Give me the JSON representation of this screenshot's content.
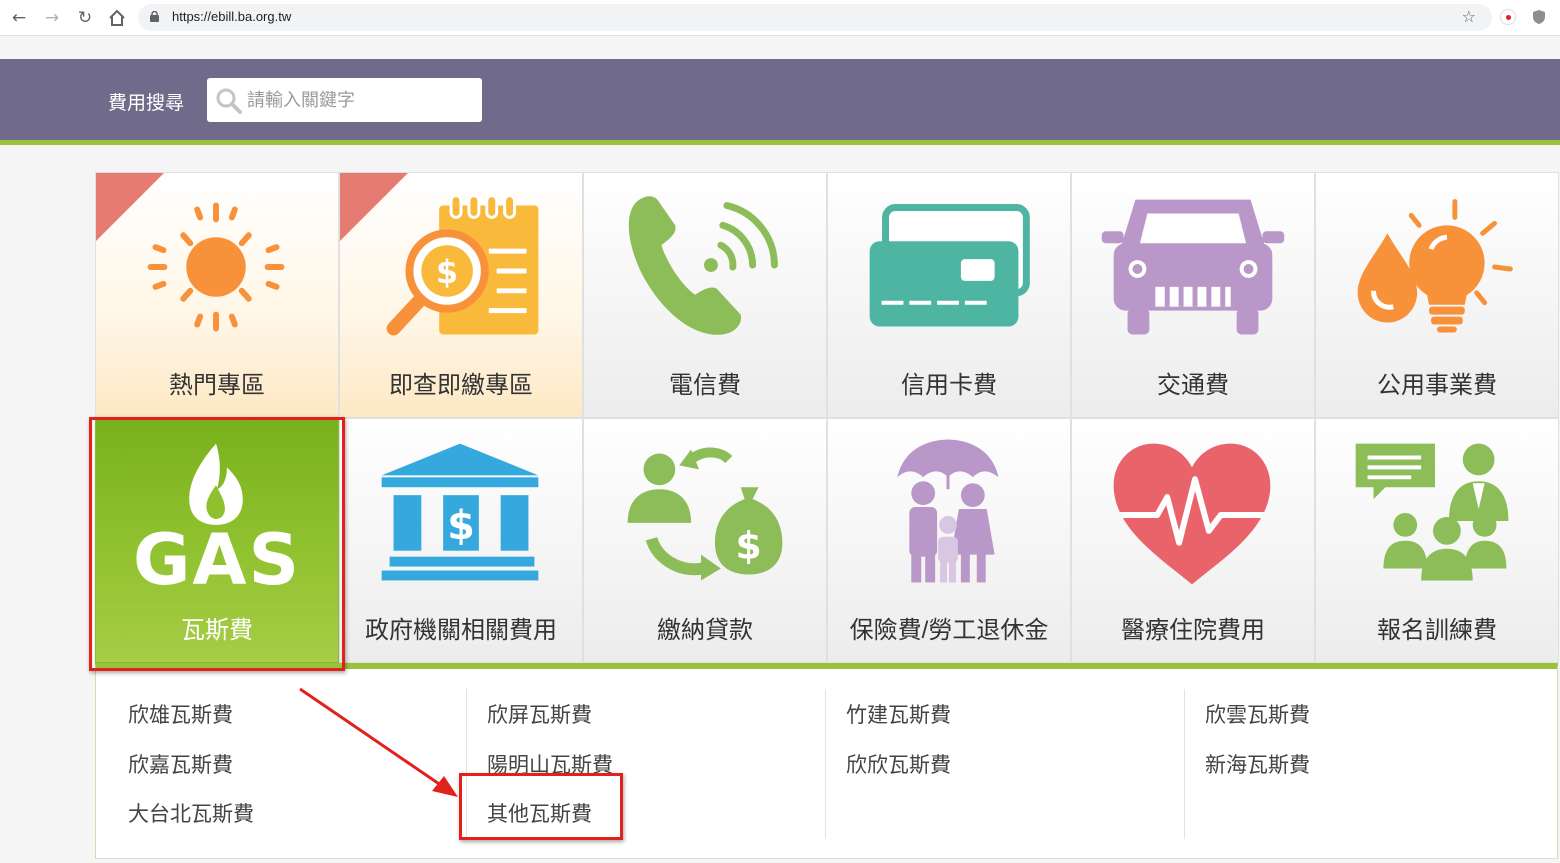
{
  "browser": {
    "url": "https://ebill.ba.org.tw"
  },
  "header": {
    "search_label": "費用搜尋",
    "search_placeholder": "請輸入關鍵字"
  },
  "tiles_row1": [
    {
      "label": "熱門專區",
      "icon": "sun-icon"
    },
    {
      "label": "即查即繳專區",
      "icon": "bill-search-icon"
    },
    {
      "label": "電信費",
      "icon": "phone-icon"
    },
    {
      "label": "信用卡費",
      "icon": "credit-card-icon"
    },
    {
      "label": "交通費",
      "icon": "car-icon"
    },
    {
      "label": "公用事業費",
      "icon": "water-bulb-icon"
    }
  ],
  "tiles_row2": [
    {
      "label": "瓦斯費",
      "icon": "gas-flame-icon",
      "gas_text": "GAS"
    },
    {
      "label": "政府機關相關費用",
      "icon": "government-building-icon"
    },
    {
      "label": "繳納貸款",
      "icon": "loan-cycle-icon"
    },
    {
      "label": "保險費/勞工退休金",
      "icon": "family-umbrella-icon"
    },
    {
      "label": "醫療住院費用",
      "icon": "heart-pulse-icon"
    },
    {
      "label": "報名訓練費",
      "icon": "training-people-icon"
    }
  ],
  "gas_submenu": [
    [
      "欣雄瓦斯費",
      "欣嘉瓦斯費",
      "大台北瓦斯費"
    ],
    [
      "欣屏瓦斯費",
      "陽明山瓦斯費",
      "其他瓦斯費"
    ],
    [
      "竹建瓦斯費",
      "欣欣瓦斯費"
    ],
    [
      "欣雲瓦斯費",
      "新海瓦斯費"
    ]
  ],
  "colors": {
    "header": "#706b8a",
    "accent_green": "#9ac33c",
    "annotation_red": "#e1211c"
  }
}
